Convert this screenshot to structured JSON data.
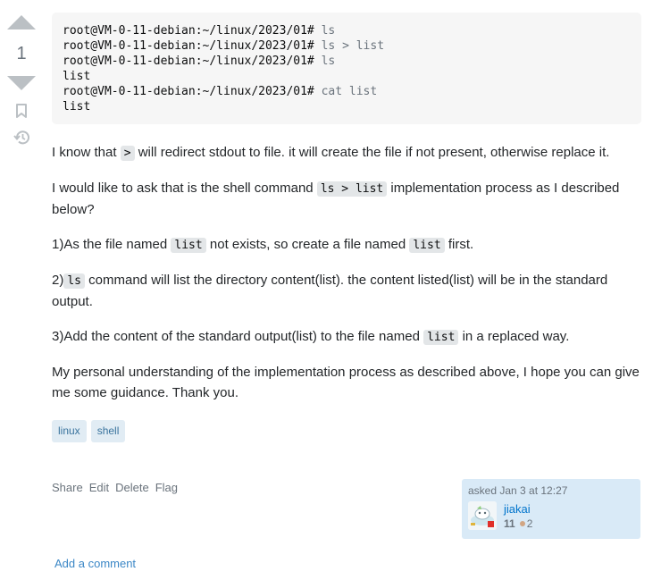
{
  "vote": {
    "count": "1",
    "upvote_icon": "triangle-up-icon",
    "downvote_icon": "triangle-down-icon",
    "bookmark_icon": "bookmark-icon",
    "history_icon": "history-icon"
  },
  "code": {
    "lines": [
      {
        "prompt": "root@VM-0-11-debian:~/linux/2023/01# ",
        "cmd": "ls"
      },
      {
        "prompt": "root@VM-0-11-debian:~/linux/2023/01# ",
        "cmd": "ls > list"
      },
      {
        "prompt": "root@VM-0-11-debian:~/linux/2023/01# ",
        "cmd": "ls"
      },
      {
        "prompt": "list",
        "cmd": ""
      },
      {
        "prompt": "root@VM-0-11-debian:~/linux/2023/01# ",
        "cmd": "cat list"
      },
      {
        "prompt": "list",
        "cmd": ""
      }
    ]
  },
  "body": {
    "p1": {
      "a": "I know that ",
      "code": ">",
      "b": " will redirect stdout to file. it will create the file if not present, otherwise replace it."
    },
    "p2": {
      "a": "I would like to ask that is the shell command ",
      "code": "ls > list",
      "b": " implementation process as I described below?"
    },
    "p3": {
      "a": "1)As the file named ",
      "code1": "list",
      "b": " not exists, so create a file named ",
      "code2": "list",
      "c": " first."
    },
    "p4": {
      "a": "2)",
      "code": "ls",
      "b": " command will list the directory content(list). the content listed(list) will be in the standard output."
    },
    "p5": {
      "a": "3)Add the content of the standard output(list) to the file named ",
      "code": "list",
      "b": " in a replaced way."
    },
    "p6": "My personal understanding of the implementation process as described above, I hope you can give me some guidance. Thank you."
  },
  "tags": [
    "linux",
    "shell"
  ],
  "actions": {
    "share": "Share",
    "edit": "Edit",
    "delete": "Delete",
    "flag": "Flag"
  },
  "owner": {
    "asked": "asked Jan 3 at 12:27",
    "name": "jiakai",
    "reputation": "11",
    "bronze_badges": "2",
    "bronze_color": "#d1a684"
  },
  "comment": {
    "add_label": "Add a comment"
  },
  "colors": {
    "link": "#0074cc",
    "tag_bg": "#e1ecf4",
    "tag_text": "#39739d",
    "owner_bg": "#d9eaf7",
    "code_bg": "#f6f6f6"
  }
}
